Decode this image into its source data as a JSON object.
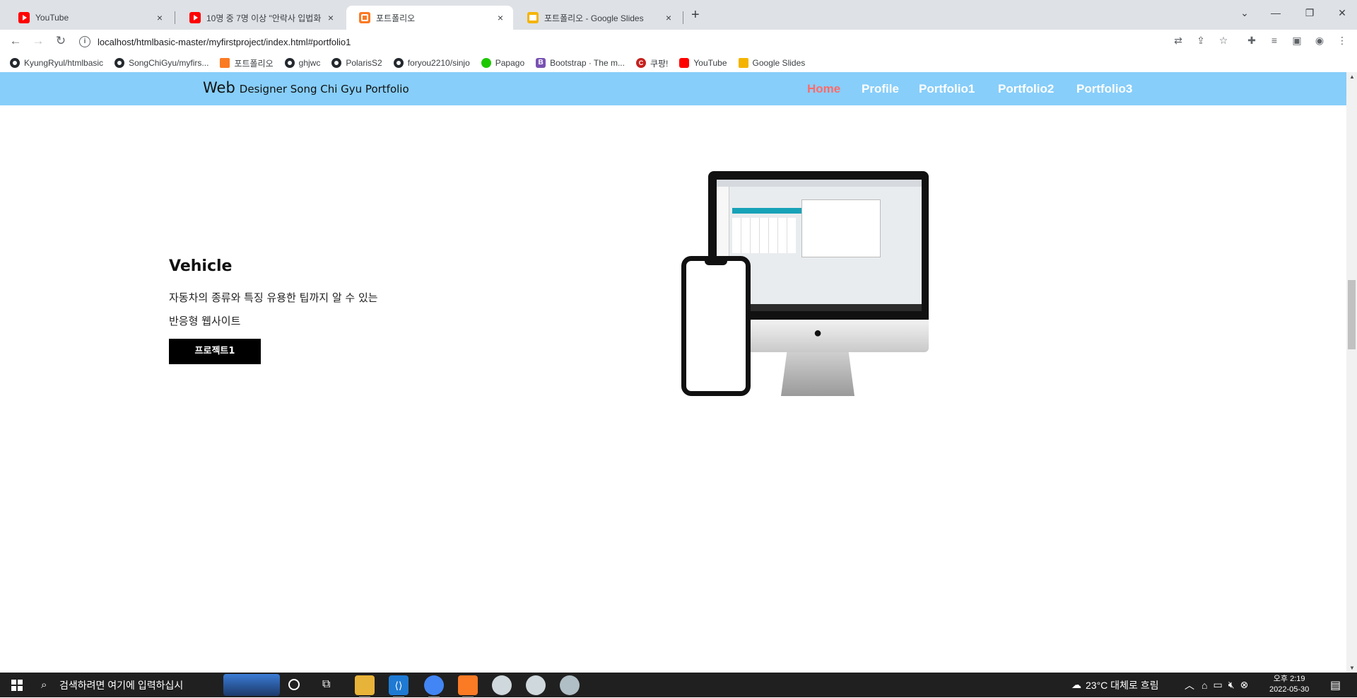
{
  "browser": {
    "tabs": [
      {
        "title": "YouTube",
        "icon": "youtube-icon",
        "active": false
      },
      {
        "title": "10명 중 7명 이상 \"안락사 입법화",
        "icon": "youtube-icon",
        "active": false
      },
      {
        "title": "포트폴리오",
        "icon": "xampp-icon",
        "active": true
      },
      {
        "title": "포트폴리오 - Google Slides",
        "icon": "slides-icon",
        "active": false
      }
    ],
    "new_tab": "+",
    "close_glyph": "×",
    "url": "localhost/htmlbasic-master/myfirstproject/index.html#portfolio1",
    "bookmarks": [
      {
        "label": "KyungRyul/htmlbasic",
        "icon": "github-icon"
      },
      {
        "label": "SongChiGyu/myfirs...",
        "icon": "github-icon"
      },
      {
        "label": "포트폴리오",
        "icon": "xampp-icon"
      },
      {
        "label": "ghjwc",
        "icon": "github-icon"
      },
      {
        "label": "PolarisS2",
        "icon": "github-icon"
      },
      {
        "label": "foryou2210/sinjo",
        "icon": "github-icon"
      },
      {
        "label": "Papago",
        "icon": "papago-icon"
      },
      {
        "label": "Bootstrap · The m...",
        "icon": "bootstrap-icon"
      },
      {
        "label": "쿠팡!",
        "icon": "coupang-icon"
      },
      {
        "label": "YouTube",
        "icon": "youtube-icon"
      },
      {
        "label": "Google Slides",
        "icon": "slides-icon"
      }
    ]
  },
  "site": {
    "logo_main": "Web",
    "logo_sub": "Designer Song Chi Gyu Portfolio",
    "nav": [
      {
        "label": "Home",
        "active": true
      },
      {
        "label": "Profile",
        "active": false
      },
      {
        "label": "Portfolio1",
        "active": false
      },
      {
        "label": "Portfolio2",
        "active": false
      },
      {
        "label": "Portfolio3",
        "active": false
      }
    ],
    "portfolio": {
      "title": "Vehicle",
      "desc_line1": "자동차의 종류와 특징 유용한 팁까지 알 수 있는",
      "desc_line2": "반응형 웹사이트",
      "button_label": "프로젝트1"
    },
    "colors": {
      "nav_bg": "#87cefa",
      "nav_active": "#ff6b6b",
      "button_bg": "#000000"
    }
  },
  "taskbar": {
    "search_placeholder": "검색하려면 여기에 입력하십시",
    "weather": "23°C 대체로 흐림",
    "time": "오후 2:19",
    "date": "2022-05-30"
  }
}
